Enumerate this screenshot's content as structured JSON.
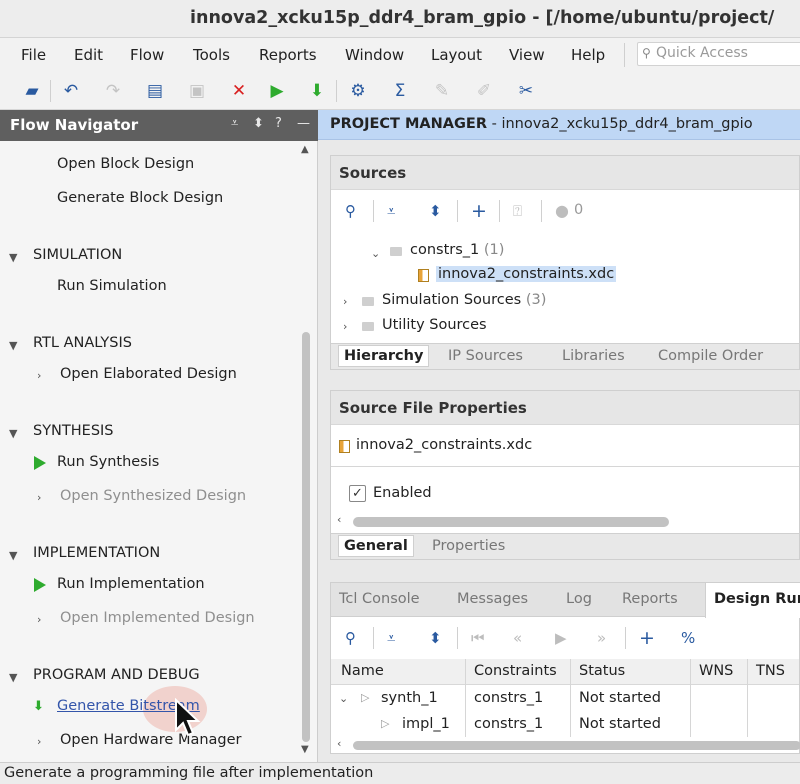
{
  "window": {
    "title": "innova2_xcku15p_ddr4_bram_gpio - [/home/ubuntu/project/"
  },
  "menu": [
    "File",
    "Edit",
    "Flow",
    "Tools",
    "Reports",
    "Window",
    "Layout",
    "View",
    "Help"
  ],
  "quick_access": {
    "placeholder": "Quick Access"
  },
  "toolbar": {
    "icons": [
      "open-project-icon",
      "undo-icon",
      "redo-icon",
      "copy-icon",
      "paste-icon",
      "delete-icon",
      "run-icon",
      "program-icon",
      "settings-icon",
      "sigma-icon",
      "disabled-tool-icon",
      "disabled-tool-icon",
      "autoconnect-icon"
    ]
  },
  "flow_navigator": {
    "title": "Flow Navigator",
    "items": {
      "open_block_design": "Open Block Design",
      "generate_block_design": "Generate Block Design",
      "simulation": "SIMULATION",
      "run_simulation": "Run Simulation",
      "rtl_analysis": "RTL ANALYSIS",
      "open_elaborated_design": "Open Elaborated Design",
      "synthesis": "SYNTHESIS",
      "run_synthesis": "Run Synthesis",
      "open_synthesized_design": "Open Synthesized Design",
      "implementation": "IMPLEMENTATION",
      "run_implementation": "Run Implementation",
      "open_implemented_design": "Open Implemented Design",
      "program_and_debug": "PROGRAM AND DEBUG",
      "generate_bitstream": "Generate Bitstream",
      "open_hardware_manager": "Open Hardware Manager"
    }
  },
  "project_manager": {
    "label": "PROJECT MANAGER",
    "project": "innova2_xcku15p_ddr4_bram_gpio"
  },
  "sources": {
    "title": "Sources",
    "count": "0",
    "tree": {
      "constrs": "constrs_1",
      "constrs_count": "(1)",
      "file": "innova2_constraints.xdc",
      "simulation": "Simulation Sources",
      "simulation_count": "(3)",
      "utility": "Utility Sources"
    },
    "tabs": [
      "Hierarchy",
      "IP Sources",
      "Libraries",
      "Compile Order"
    ]
  },
  "source_file_properties": {
    "title": "Source File Properties",
    "file": "innova2_constraints.xdc",
    "enabled_label": "Enabled",
    "tabs": [
      "General",
      "Properties"
    ]
  },
  "bottom_panel": {
    "tabs": [
      "Tcl Console",
      "Messages",
      "Log",
      "Reports",
      "Design Run"
    ],
    "columns": [
      "Name",
      "Constraints",
      "Status",
      "WNS",
      "TNS"
    ],
    "rows": [
      {
        "name": "synth_1",
        "constraints": "constrs_1",
        "status": "Not started"
      },
      {
        "name": "impl_1",
        "constraints": "constrs_1",
        "status": "Not started"
      }
    ]
  },
  "status_bar": {
    "text": "Generate a programming file after implementation"
  },
  "colors": {
    "accent_green": "#2eab2e",
    "header_blue": "#bfd7f5",
    "panel_dark": "#5f5f5f"
  }
}
